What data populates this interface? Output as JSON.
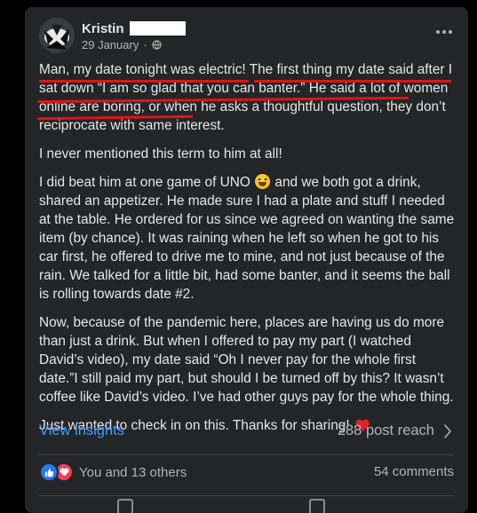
{
  "post": {
    "author_name": "Kristin",
    "date": "29 January",
    "separator": "·",
    "privacy_icon": "globe-icon",
    "paragraphs": {
      "p1_s1": "Man, my date tonight was electric!",
      "p1_s2": "The first thing my date said after I sat down “I am so glad that you can banter.” He said a lot of women online are boring,",
      "p1_s3": " or when he asks a thoughtful question, they don’t reciprocate with same interest.",
      "p2": "I never mentioned this term to him at all!",
      "p3_a": "I did beat him at one game of UNO",
      "p3_emoji": "laughing-emoji",
      "p3_b": " and we both got a drink, shared an appetizer.  He made sure I had a plate and stuff I needed at the table. He ordered for us since we agreed on wanting the same item (by chance).  It was raining when he left so when he got to his car first, he offered to drive me to mine, and not just because of the rain.  We talked for a little bit, had some banter, and it seems the ball is rolling towards date #2.",
      "p4": "Now, because of the pandemic here, places are having us do more than just a drink.  But when I offered to pay my part (I watched David’s video), my date said “Oh I never pay for the whole first date.”I still paid my part, but should I be turned off by this? It wasn’t coffee like David’s video. I’ve had other guys pay for the whole thing.",
      "p5": "Just wanted to check in on this. Thanks for sharing!",
      "p5_emoji": "red-heart-emoji"
    },
    "insights_label": "View insights",
    "reach_label": "288 post reach",
    "reactions_text": "You and 13 others",
    "comments_label": "54 comments"
  },
  "colors": {
    "card_bg": "#242526",
    "text": "#e4e6eb",
    "muted": "#b0b3b8",
    "link": "#4599ff",
    "underline": "#e0131a"
  }
}
